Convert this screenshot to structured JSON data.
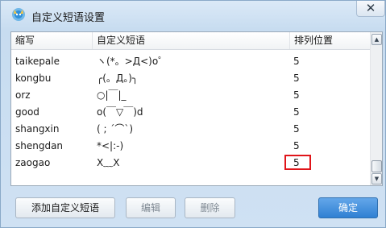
{
  "window": {
    "title": "自定义短语设置",
    "close_label": "✕",
    "icon": "app-logo-icon"
  },
  "table": {
    "columns": [
      "缩写",
      "自定义短语",
      "排列位置"
    ],
    "rows": [
      {
        "abbr": "taikepale",
        "phrase": "ヽ(*。>Д<)o゜",
        "position": "5"
      },
      {
        "abbr": "kongbu",
        "phrase": "╭(。Д。)╮",
        "position": "5"
      },
      {
        "abbr": "orz",
        "phrase": "○|￣|_",
        "position": "5"
      },
      {
        "abbr": "good",
        "phrase": "o(￣▽￣)d",
        "position": "5"
      },
      {
        "abbr": "shangxin",
        "phrase": "( ; ´⌒`)",
        "position": "5"
      },
      {
        "abbr": "shengdan",
        "phrase": "*<|:-)",
        "position": "5"
      },
      {
        "abbr": "zaogao",
        "phrase": "X﹏X",
        "position": "5"
      }
    ],
    "highlight_color": "#e0151a"
  },
  "buttons": {
    "add": "添加自定义短语",
    "edit": "编辑",
    "delete": "删除",
    "ok": "确定"
  },
  "scrollbar": {
    "up_icon": "▲",
    "down_icon": "▼"
  }
}
